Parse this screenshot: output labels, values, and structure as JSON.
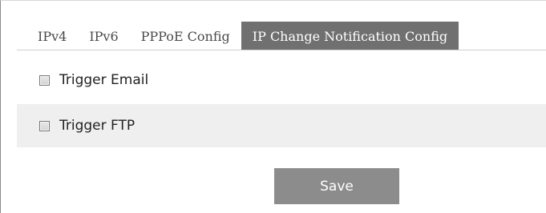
{
  "tabs": [
    {
      "label": "IPv4",
      "active": false
    },
    {
      "label": "IPv6",
      "active": false
    },
    {
      "label": "PPPoE Config",
      "active": false
    },
    {
      "label": "IP Change Notification Config",
      "active": true
    }
  ],
  "options": {
    "trigger_email": {
      "label": "Trigger Email",
      "checked": false
    },
    "trigger_ftp": {
      "label": "Trigger FTP",
      "checked": false
    }
  },
  "actions": {
    "save_label": "Save"
  },
  "colors": {
    "active_tab_bg": "#707070",
    "save_button_bg": "#8c8c8c",
    "alt_row_bg": "#efefef"
  }
}
